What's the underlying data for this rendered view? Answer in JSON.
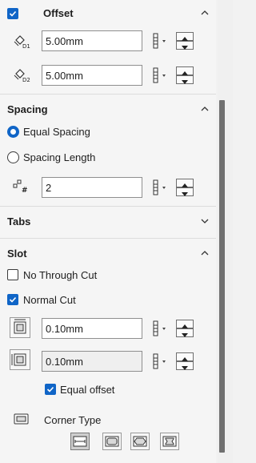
{
  "offset": {
    "title": "Offset",
    "d1": {
      "icon": "d1-dimension-icon",
      "label": "D1",
      "value": "5.00mm"
    },
    "d2": {
      "icon": "d2-dimension-icon",
      "label": "D2",
      "value": "5.00mm"
    }
  },
  "spacing": {
    "title": "Spacing",
    "equal_label": "Equal Spacing",
    "length_label": "Spacing Length",
    "count_value": "2",
    "count_icon_label": "#"
  },
  "tabs": {
    "title": "Tabs"
  },
  "slot": {
    "title": "Slot",
    "no_through_cut_label": "No Through Cut",
    "normal_cut_label": "Normal Cut",
    "width_value": "0.10mm",
    "length_value": "0.10mm",
    "equal_offset_label": "Equal offset",
    "corner_type_label": "Corner Type",
    "corner_types": [
      "rectangular-corner",
      "rounded-corner",
      "capsule-corner",
      "notched-corner"
    ]
  },
  "colors": {
    "accent": "#1065c7",
    "scroll_thumb": "#707070"
  }
}
